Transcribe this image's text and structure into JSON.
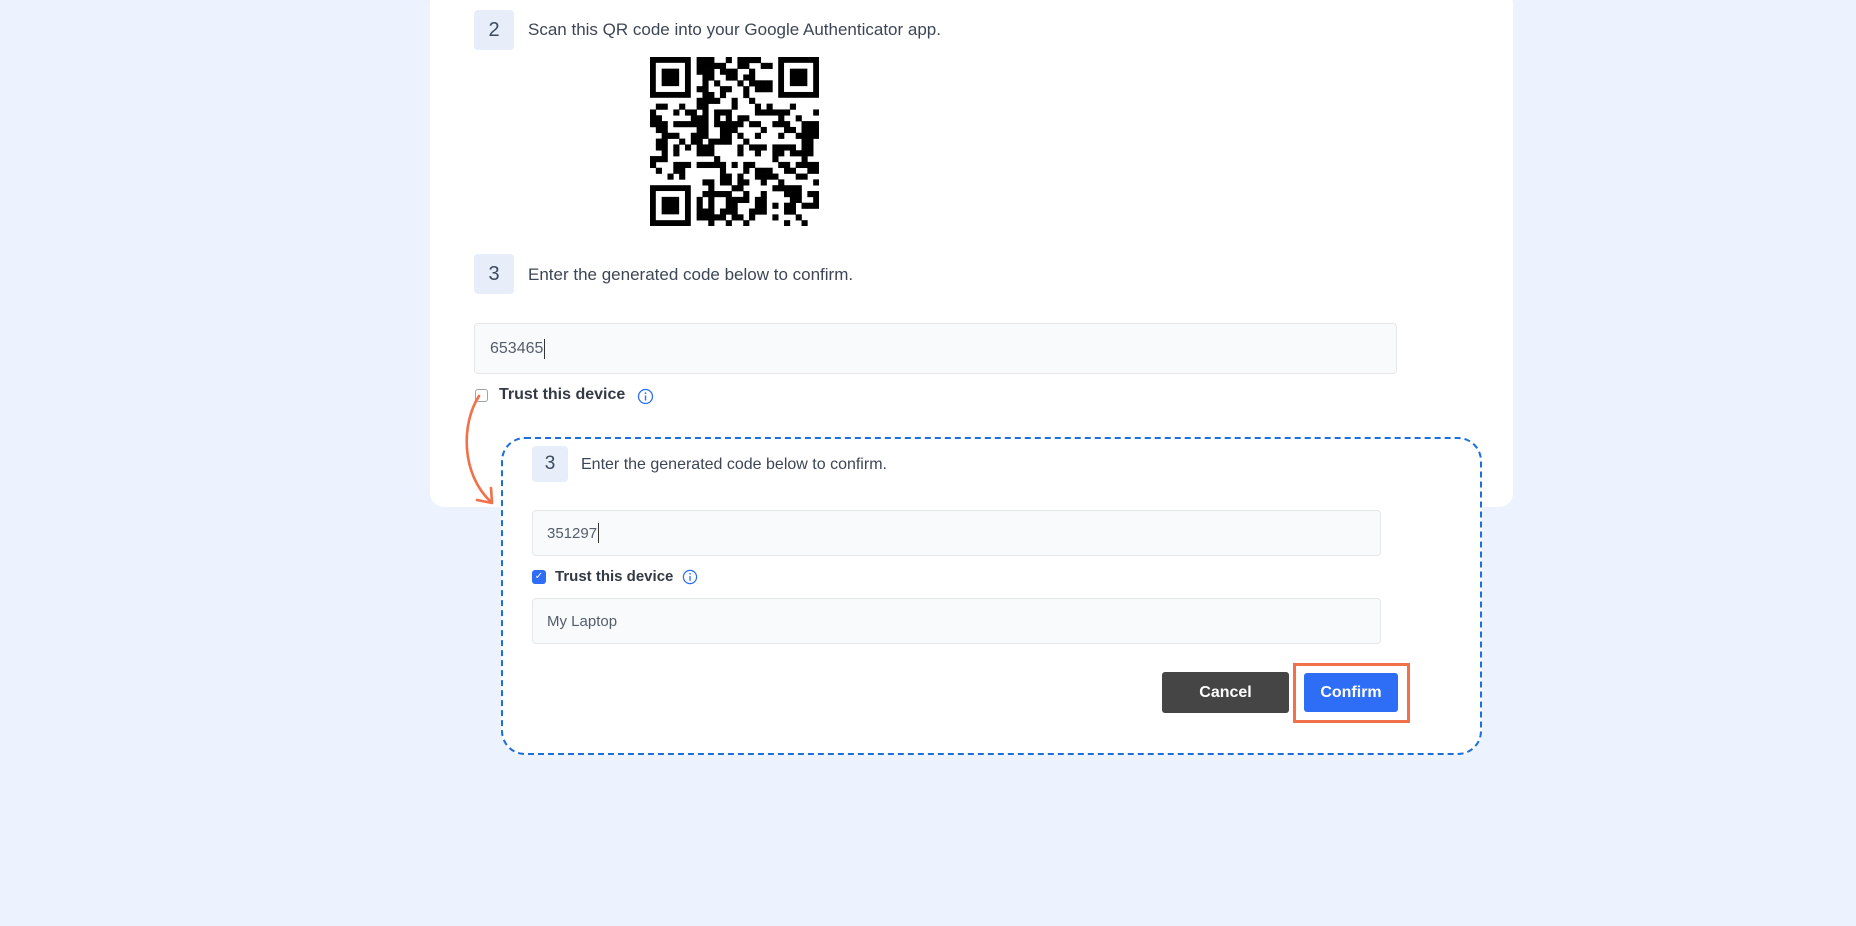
{
  "colors": {
    "page_background": "#edf3fe",
    "primary": "#2e6df6",
    "cancel_button": "#454545",
    "highlight": "#f0714a",
    "zoom_border": "#1d6fdc"
  },
  "steps": {
    "step2": {
      "number": "2",
      "text": "Scan this QR code into your Google Authenticator app."
    },
    "step3": {
      "number": "3",
      "text": "Enter the generated code below to confirm.",
      "code_value": "653465",
      "trust_label": "Trust this device",
      "trust_checked": false
    }
  },
  "zoomed": {
    "number": "3",
    "text": "Enter the generated code below to confirm.",
    "code_value": "351297",
    "trust_label": "Trust this device",
    "trust_checked": true,
    "device_name_value": "My Laptop",
    "cancel_label": "Cancel",
    "confirm_label": "Confirm"
  },
  "icons": {
    "qr": "qr-code-icon",
    "info": "info-icon",
    "check": "checkmark-icon",
    "arrow": "curved-arrow-icon"
  }
}
